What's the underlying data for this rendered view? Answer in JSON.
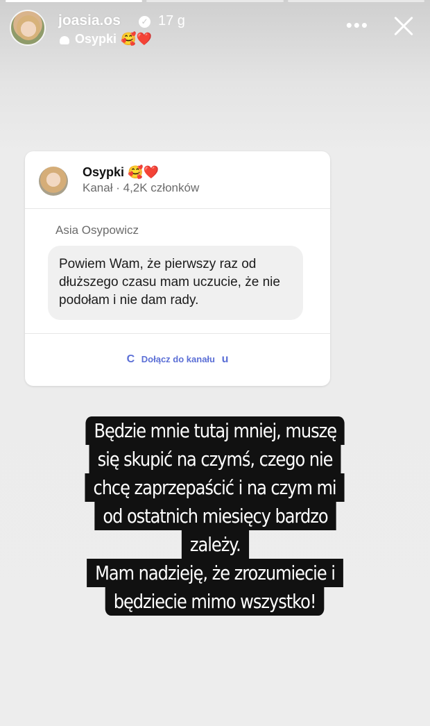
{
  "header": {
    "username": "joasia.os",
    "verified_icon": "verified-check-icon",
    "time": "17 g",
    "music_title": "Osypki",
    "music_emoji": "🥰❤️",
    "more_label": "•••"
  },
  "progress": {
    "segments": 3,
    "completed": 1
  },
  "card": {
    "channel_name": "Osypki",
    "channel_emoji": "🥰❤️",
    "channel_type": "Kanał",
    "members": "4,2K członków",
    "sender": "Asia Osypowicz",
    "message": "Powiem Wam, że pierwszy raz od dłuższego czasu mam uczucie, że nie podołam i nie dam rady.",
    "join_label": "Dołącz do kanału",
    "join_left_glyph": "C",
    "join_right_glyph": "u"
  },
  "caption": {
    "lines": [
      "Będzie mnie tutaj mniej, muszę",
      "się skupić na czymś, czego nie",
      "chcę zaprzepaścić i na czym mi",
      "od ostatnich miesięcy bardzo",
      "zależy.",
      "Mam nadzieję, że zrozumiecie i",
      "będziecie mimo wszystko!"
    ]
  }
}
